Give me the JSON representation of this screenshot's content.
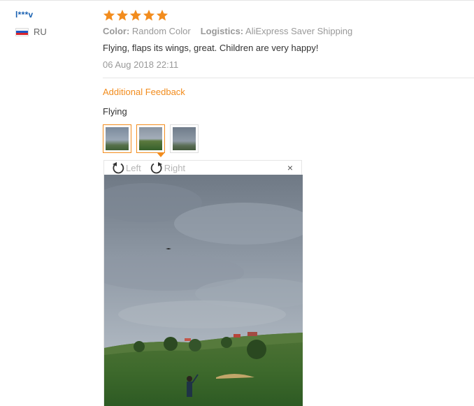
{
  "review": {
    "username": "l***v",
    "country_code": "RU",
    "rating": 5,
    "star_color": "#f28c1d",
    "color_label": "Color:",
    "color_value": "Random Color",
    "logistics_label": "Logistics:",
    "logistics_value": "AliExpress Saver Shipping",
    "comment": "Flying, flaps its wings, great. Children are very happy!",
    "date": "06 Aug 2018 22:11"
  },
  "additional": {
    "title": "Additional Feedback",
    "text": "Flying"
  },
  "gallery": {
    "thumb_count": 3,
    "selected_index": 1
  },
  "viewer": {
    "rotate_left_label": "Left",
    "rotate_right_label": "Right",
    "close_icon": "close-icon",
    "close_glyph": "×"
  },
  "colors": {
    "accent": "#f28c1d",
    "username": "#1a62b2",
    "muted": "#999999"
  }
}
